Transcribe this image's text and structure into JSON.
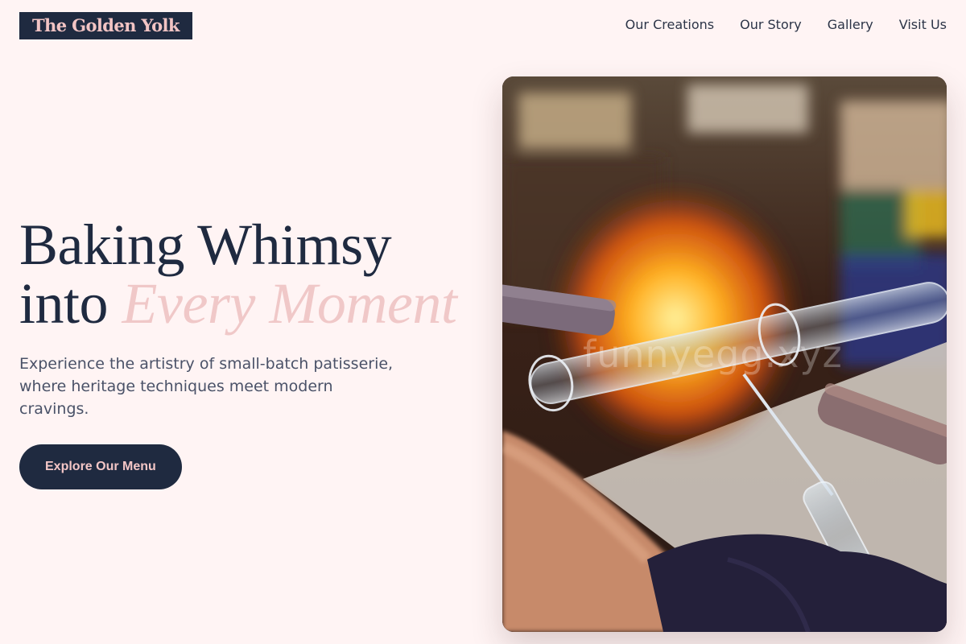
{
  "brand": {
    "name": "The Golden Yolk"
  },
  "nav": {
    "items": [
      {
        "label": "Our Creations"
      },
      {
        "label": "Our Story"
      },
      {
        "label": "Gallery"
      },
      {
        "label": "Visit Us"
      }
    ]
  },
  "hero": {
    "headline_line1": "Baking Whimsy",
    "headline_line2_plain": "into",
    "headline_line2_accent": "Every Moment",
    "description": "Experience the artistry of small-batch patisserie, where heritage techniques meet modern cravings.",
    "cta_label": "Explore Our Menu"
  },
  "photo": {
    "watermark": "funnyegg.xyz"
  },
  "colors": {
    "background": "#fff4f4",
    "navy": "#1f2a40",
    "pink_accent": "#f0c8c8"
  }
}
